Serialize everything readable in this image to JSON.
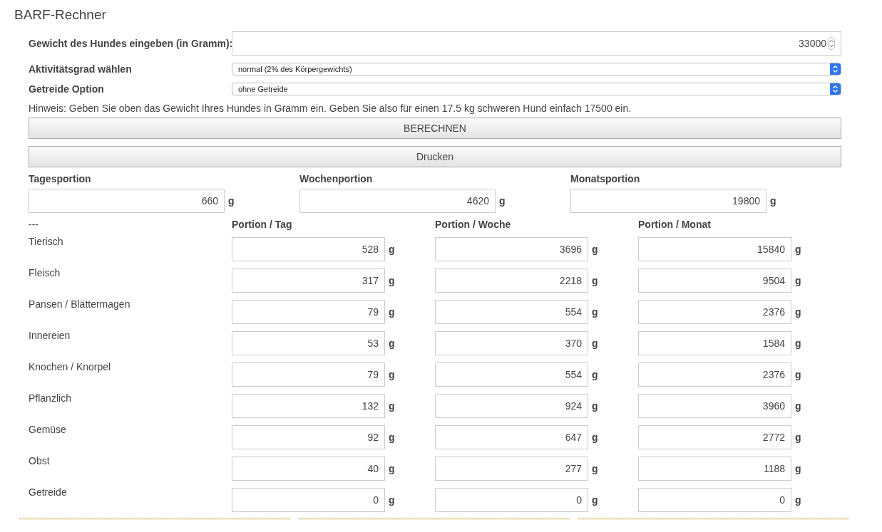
{
  "title": "BARF-Rechner",
  "form": {
    "weight": {
      "label": "Gewicht des Hundes eingeben (in Gramm):",
      "value": "33000"
    },
    "activity": {
      "label": "Aktivitätsgrad wählen",
      "value": "normal (2% des Körpergewichts)"
    },
    "grain": {
      "label": "Getreide Option",
      "value": "ohne Getreide"
    }
  },
  "hint": "Hinweis: Geben Sie oben das Gewicht Ihres Hundes in Gramm ein. Geben Sie also für einen 17.5 kg schweren Hund einfach 17500 ein.",
  "buttons": [
    "BERECHNEN",
    "Drucken"
  ],
  "totals": [
    {
      "label": "Tagesportion",
      "value": "660",
      "unit": "g"
    },
    {
      "label": "Wochenportion",
      "value": "4620",
      "unit": "g"
    },
    {
      "label": "Monatsportion",
      "value": "19800",
      "unit": "g"
    }
  ],
  "table": {
    "columns": [
      "---",
      "Portion / Tag",
      "Portion / Woche",
      "Portion / Monat"
    ],
    "rows": [
      {
        "label": "Tierisch",
        "cells": [
          {
            "value": "528",
            "unit": "g"
          },
          {
            "value": "3696",
            "unit": "g"
          },
          {
            "value": "15840",
            "unit": "g"
          }
        ]
      },
      {
        "label": "Fleisch",
        "cells": [
          {
            "value": "317",
            "unit": "g"
          },
          {
            "value": "2218",
            "unit": "g"
          },
          {
            "value": "9504",
            "unit": "g"
          }
        ]
      },
      {
        "label": "Pansen / Blättermagen",
        "cells": [
          {
            "value": "79",
            "unit": "g"
          },
          {
            "value": "554",
            "unit": "g"
          },
          {
            "value": "2376",
            "unit": "g"
          }
        ]
      },
      {
        "label": "Innereien",
        "cells": [
          {
            "value": "53",
            "unit": "g"
          },
          {
            "value": "370",
            "unit": "g"
          },
          {
            "value": "1584",
            "unit": "g"
          }
        ]
      },
      {
        "label": "Knochen / Knorpel",
        "cells": [
          {
            "value": "79",
            "unit": "g"
          },
          {
            "value": "554",
            "unit": "g"
          },
          {
            "value": "2376",
            "unit": "g"
          }
        ]
      },
      {
        "label": "Pflanzlich",
        "cells": [
          {
            "value": "132",
            "unit": "g"
          },
          {
            "value": "924",
            "unit": "g"
          },
          {
            "value": "3960",
            "unit": "g"
          }
        ]
      },
      {
        "label": "Gemüse",
        "cells": [
          {
            "value": "92",
            "unit": "g"
          },
          {
            "value": "647",
            "unit": "g"
          },
          {
            "value": "2772",
            "unit": "g"
          }
        ]
      },
      {
        "label": "Obst",
        "cells": [
          {
            "value": "40",
            "unit": "g"
          },
          {
            "value": "277",
            "unit": "g"
          },
          {
            "value": "1188",
            "unit": "g"
          }
        ]
      },
      {
        "label": "Getreide",
        "cells": [
          {
            "value": "0",
            "unit": "g"
          },
          {
            "value": "0",
            "unit": "g"
          },
          {
            "value": "0",
            "unit": "g"
          }
        ]
      }
    ]
  }
}
